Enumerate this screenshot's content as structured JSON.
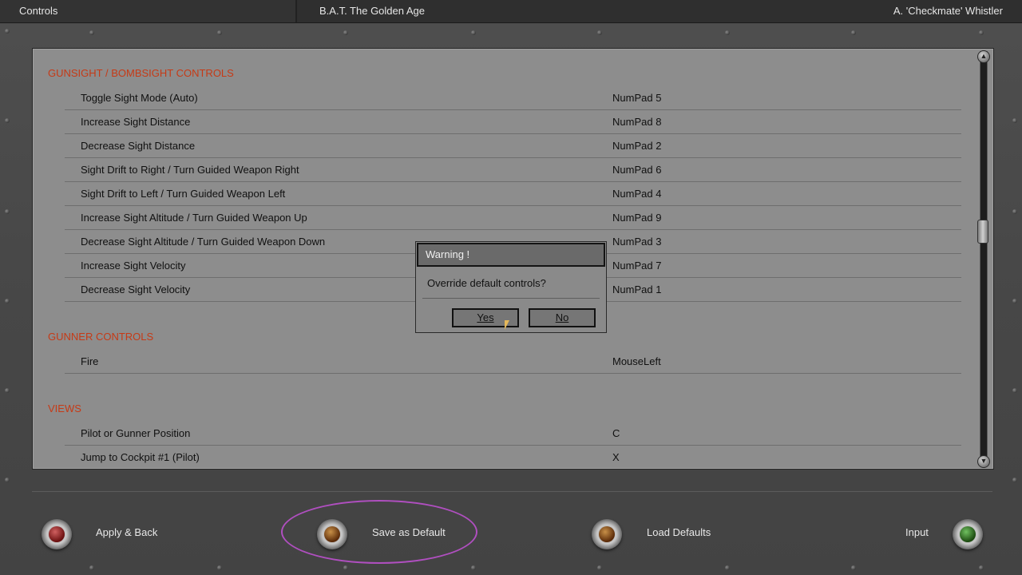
{
  "topbar": {
    "section": "Controls",
    "game_title": "B.A.T. The Golden Age",
    "player": "A. 'Checkmate' Whistler"
  },
  "sections": [
    {
      "title": "GUNSIGHT / BOMBSIGHT CONTROLS",
      "rows": [
        {
          "label": "Toggle Sight Mode (Auto)",
          "key": "NumPad 5"
        },
        {
          "label": "Increase Sight Distance",
          "key": "NumPad 8"
        },
        {
          "label": "Decrease Sight Distance",
          "key": "NumPad 2"
        },
        {
          "label": "Sight Drift to Right / Turn Guided Weapon Right",
          "key": "NumPad 6"
        },
        {
          "label": "Sight Drift to Left / Turn Guided Weapon Left",
          "key": "NumPad 4"
        },
        {
          "label": "Increase Sight Altitude / Turn Guided Weapon Up",
          "key": "NumPad 9"
        },
        {
          "label": "Decrease Sight Altitude / Turn Guided Weapon Down",
          "key": "NumPad 3"
        },
        {
          "label": "Increase Sight Velocity",
          "key": "NumPad 7"
        },
        {
          "label": "Decrease Sight Velocity",
          "key": "NumPad 1"
        }
      ]
    },
    {
      "title": "GUNNER CONTROLS",
      "rows": [
        {
          "label": "Fire",
          "key": "MouseLeft"
        }
      ]
    },
    {
      "title": "VIEWS",
      "rows": [
        {
          "label": "Pilot or Gunner Position",
          "key": "C"
        },
        {
          "label": "Jump to Cockpit #1 (Pilot)",
          "key": "X"
        }
      ]
    }
  ],
  "dialog": {
    "title": "Warning !",
    "message": "Override default controls?",
    "yes_label": "Yes",
    "no_label": "No"
  },
  "bottom": {
    "apply_label": "Apply & Back",
    "save_default_label": "Save as Default",
    "load_defaults_label": "Load Defaults",
    "input_label": "Input"
  },
  "colors": {
    "section_title": "#c63a16",
    "highlight": "#b04fc0"
  }
}
